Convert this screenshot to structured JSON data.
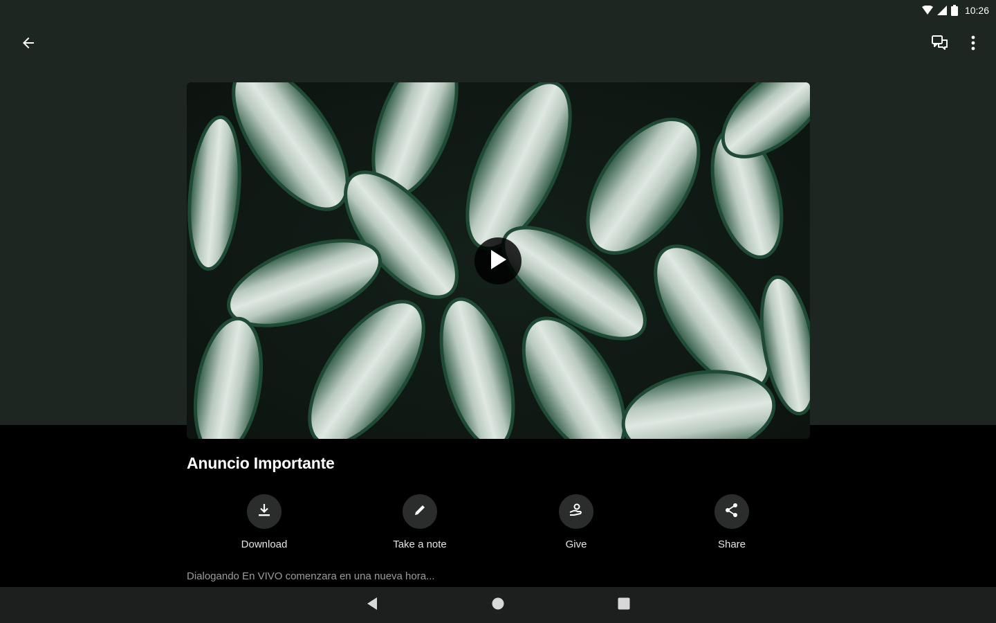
{
  "status_bar": {
    "time": "10:26",
    "icons": [
      "wifi-icon",
      "signal-icon",
      "battery-icon"
    ]
  },
  "app_bar": {
    "back_icon": "arrow-left-icon",
    "chat_icon": "chat-bubbles-icon",
    "more_icon": "more-vertical-icon"
  },
  "media": {
    "play_icon": "play-icon"
  },
  "content": {
    "title": "Anuncio Importante",
    "description": "Dialogando En VIVO comenzara en una nueva hora..."
  },
  "actions": [
    {
      "label": "Download",
      "icon": "download-icon"
    },
    {
      "label": "Take a note",
      "icon": "pencil-icon"
    },
    {
      "label": "Give",
      "icon": "give-hand-icon"
    },
    {
      "label": "Share",
      "icon": "share-icon"
    }
  ],
  "nav_bar": {
    "icons": [
      "nav-back-icon",
      "nav-home-icon",
      "nav-recents-icon"
    ]
  },
  "colors": {
    "top_background": "#1e2622",
    "bottom_background": "#000000",
    "action_circle": "#2a2d2c",
    "nav_background": "#1d1f1e"
  }
}
